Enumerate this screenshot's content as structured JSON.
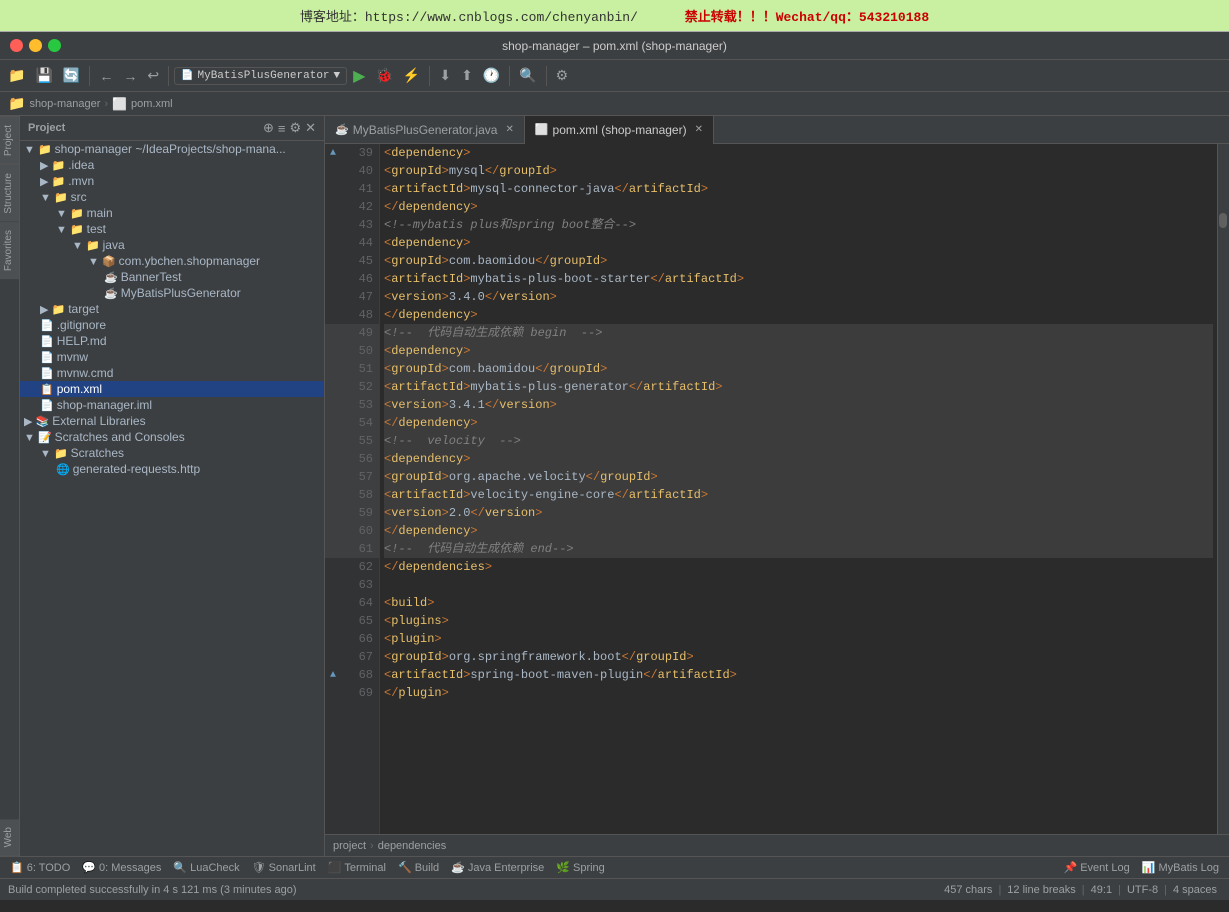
{
  "banner": {
    "text": "博客地址：https://www.cnblogs.com/chenyanbin/",
    "warning": "禁止转载！！！Wechat/qq：543210188"
  },
  "titleBar": {
    "title": "shop-manager – pom.xml (shop-manager)",
    "windowButtons": [
      "close",
      "minimize",
      "maximize"
    ]
  },
  "toolbar": {
    "dropdownLabel": "MyBatisPlusGenerator",
    "buttons": [
      "folder",
      "save",
      "refresh",
      "back",
      "forward",
      "revert"
    ]
  },
  "breadcrumb": {
    "items": [
      "shop-manager",
      "pom.xml"
    ]
  },
  "sidebar": {
    "header": "Project",
    "tree": [
      {
        "label": "shop-manager ~/IdeaProjects/shop-mana...",
        "level": 0,
        "type": "project",
        "expanded": true
      },
      {
        "label": ".idea",
        "level": 1,
        "type": "folder",
        "expanded": false
      },
      {
        "label": ".mvn",
        "level": 1,
        "type": "folder",
        "expanded": false
      },
      {
        "label": "src",
        "level": 1,
        "type": "folder",
        "expanded": true
      },
      {
        "label": "main",
        "level": 2,
        "type": "folder",
        "expanded": true
      },
      {
        "label": "test",
        "level": 2,
        "type": "folder",
        "expanded": true
      },
      {
        "label": "java",
        "level": 3,
        "type": "folder",
        "expanded": true
      },
      {
        "label": "com.ybchen.shopmanager",
        "level": 4,
        "type": "package",
        "expanded": true
      },
      {
        "label": "BannerTest",
        "level": 5,
        "type": "java"
      },
      {
        "label": "MyBatisPlusGenerator",
        "level": 5,
        "type": "java"
      },
      {
        "label": "target",
        "level": 1,
        "type": "folder",
        "expanded": false
      },
      {
        "label": ".gitignore",
        "level": 1,
        "type": "file"
      },
      {
        "label": "HELP.md",
        "level": 1,
        "type": "file"
      },
      {
        "label": "mvnw",
        "level": 1,
        "type": "file"
      },
      {
        "label": "mvnw.cmd",
        "level": 1,
        "type": "file"
      },
      {
        "label": "pom.xml",
        "level": 1,
        "type": "xml",
        "selected": true
      },
      {
        "label": "shop-manager.iml",
        "level": 1,
        "type": "file"
      },
      {
        "label": "External Libraries",
        "level": 0,
        "type": "library",
        "expanded": false
      },
      {
        "label": "Scratches and Consoles",
        "level": 0,
        "type": "scratches",
        "expanded": true
      },
      {
        "label": "Scratches",
        "level": 1,
        "type": "folder",
        "expanded": true
      },
      {
        "label": "generated-requests.http",
        "level": 2,
        "type": "http"
      }
    ]
  },
  "tabs": [
    {
      "label": "MyBatisPlusGenerator.java",
      "active": false,
      "icon": "java"
    },
    {
      "label": "pom.xml (shop-manager)",
      "active": true,
      "icon": "xml"
    }
  ],
  "code": {
    "lines": [
      {
        "num": 39,
        "gutter": "▲",
        "content": "    <dependency>",
        "highlight": false
      },
      {
        "num": 40,
        "gutter": "",
        "content": "        <groupId>mysql</groupId>",
        "highlight": false
      },
      {
        "num": 41,
        "gutter": "",
        "content": "        <artifactId>mysql-connector-java</artifactId>",
        "highlight": false
      },
      {
        "num": 42,
        "gutter": "",
        "content": "    </dependency>",
        "highlight": false
      },
      {
        "num": 43,
        "gutter": "",
        "content": "    <!--mybatis plus和spring boot整合-->",
        "highlight": false
      },
      {
        "num": 44,
        "gutter": "",
        "content": "    <dependency>",
        "highlight": false
      },
      {
        "num": 45,
        "gutter": "",
        "content": "        <groupId>com.baomidou</groupId>",
        "highlight": false
      },
      {
        "num": 46,
        "gutter": "",
        "content": "        <artifactId>mybatis-plus-boot-starter</artifactId>",
        "highlight": false
      },
      {
        "num": 47,
        "gutter": "",
        "content": "        <version>3.4.0</version>",
        "highlight": false
      },
      {
        "num": 48,
        "gutter": "",
        "content": "    </dependency>",
        "highlight": false
      },
      {
        "num": 49,
        "gutter": "",
        "content": "    <!--  代码自动生成依赖 begin  -->",
        "highlight": true,
        "selected": true
      },
      {
        "num": 50,
        "gutter": "",
        "content": "    <dependency>",
        "highlight": true
      },
      {
        "num": 51,
        "gutter": "",
        "content": "        <groupId>com.baomidou</groupId>",
        "highlight": true
      },
      {
        "num": 52,
        "gutter": "",
        "content": "        <artifactId>mybatis-plus-generator</artifactId>",
        "highlight": true
      },
      {
        "num": 53,
        "gutter": "",
        "content": "        <version>3.4.1</version>",
        "highlight": true
      },
      {
        "num": 54,
        "gutter": "",
        "content": "    </dependency>",
        "highlight": true
      },
      {
        "num": 55,
        "gutter": "",
        "content": "    <!--  velocity  -->",
        "highlight": true
      },
      {
        "num": 56,
        "gutter": "",
        "content": "    <dependency>",
        "highlight": true
      },
      {
        "num": 57,
        "gutter": "",
        "content": "        <groupId>org.apache.velocity</groupId>",
        "highlight": true
      },
      {
        "num": 58,
        "gutter": "",
        "content": "        <artifactId>velocity-engine-core</artifactId>",
        "highlight": true
      },
      {
        "num": 59,
        "gutter": "",
        "content": "        <version>2.0</version>",
        "highlight": true
      },
      {
        "num": 60,
        "gutter": "",
        "content": "    </dependency>",
        "highlight": true
      },
      {
        "num": 61,
        "gutter": "",
        "content": "    <!--  代码自动生成依赖 end-->",
        "highlight": true
      },
      {
        "num": 62,
        "gutter": "",
        "content": "    </dependencies>",
        "highlight": false
      },
      {
        "num": 63,
        "gutter": "",
        "content": "",
        "highlight": false
      },
      {
        "num": 64,
        "gutter": "",
        "content": "    <build>",
        "highlight": false
      },
      {
        "num": 65,
        "gutter": "",
        "content": "        <plugins>",
        "highlight": false
      },
      {
        "num": 66,
        "gutter": "",
        "content": "            <plugin>",
        "highlight": false
      },
      {
        "num": 67,
        "gutter": "",
        "content": "                <groupId>org.springframework.boot</groupId>",
        "highlight": false
      },
      {
        "num": 68,
        "gutter": "▲",
        "content": "                <artifactId>spring-boot-maven-plugin</artifactId>",
        "highlight": false
      },
      {
        "num": 69,
        "gutter": "",
        "content": "            </plugin>",
        "highlight": false
      }
    ]
  },
  "codeBreadcrumb": {
    "items": [
      "project",
      "dependencies"
    ]
  },
  "statusBar": {
    "chars": "457 chars",
    "lineBreaks": "12 line breaks",
    "position": "49:1",
    "encoding": "UTF-8",
    "indent": "4 spaces"
  },
  "bottomPanels": [
    {
      "label": "6: TODO",
      "badge": "6"
    },
    {
      "label": "0: Messages",
      "badge": "0"
    },
    {
      "label": "LuaCheck"
    },
    {
      "label": "SonarLint"
    },
    {
      "label": "Terminal"
    },
    {
      "label": "Build"
    },
    {
      "label": "Java Enterprise"
    },
    {
      "label": "Spring"
    },
    {
      "label": "Event Log"
    },
    {
      "label": "MyBatis Log"
    }
  ],
  "buildStatus": {
    "text": "Build completed successfully in 4 s 121 ms (3 minutes ago)"
  }
}
